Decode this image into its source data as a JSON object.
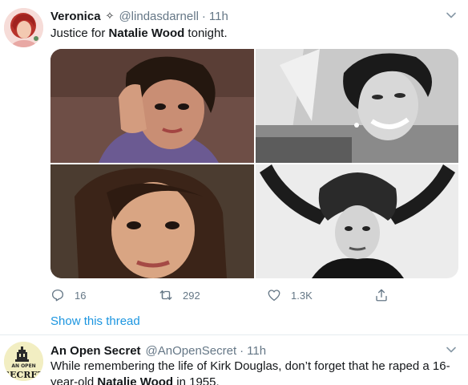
{
  "tweets": [
    {
      "author_name": "Veronica",
      "badge_glyph": "✧",
      "handle": "@lindasdarnell",
      "separator": "·",
      "time": "11h",
      "text_before": "Justice for ",
      "text_bold": "Natalie Wood",
      "text_after": " tonight.",
      "photos": [
        "Natalie Wood color portrait, hand in hair, purple blouse",
        "Natalie Wood black and white, laughing on sailboat",
        "Natalie Wood color close-up portrait",
        "Natalie Wood black and white, arms raised over head"
      ],
      "reply_count": "16",
      "retweet_count": "292",
      "like_count": "1.3K",
      "show_thread": "Show this thread"
    },
    {
      "author_name": "An Open Secret",
      "handle": "@AnOpenSecret",
      "separator": "·",
      "time": "11h",
      "text_before": "While remembering the life of Kirk Douglas, don’t forget that he raped a 16-year-old ",
      "text_bold": "Natalie Wood",
      "text_after": " in 1955.",
      "avatar_text_top": "AN OPEN",
      "avatar_text_bottom": "SECRET"
    }
  ],
  "colors": {
    "link": "#1b95e0",
    "muted": "#657786",
    "text": "#14171a",
    "divider": "#e6ecf0"
  }
}
